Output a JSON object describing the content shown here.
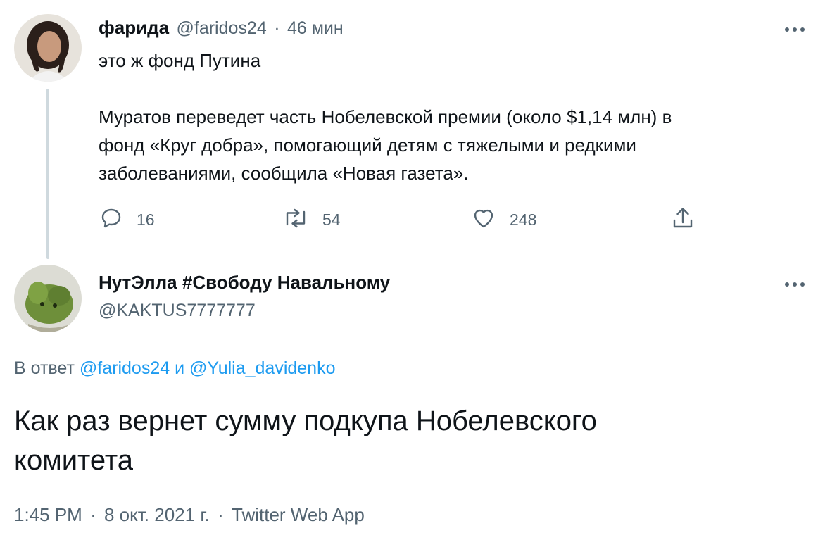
{
  "parent_tweet": {
    "author_name": "фарида",
    "author_handle": "@faridos24",
    "separator": "·",
    "time_ago": "46 мин",
    "text_line1": "это ж фонд Путина",
    "quote_line1": "Муратов переведет часть Нобелевской премии (около $1,14 млн) в",
    "quote_line2": "фонд «Круг добра», помогающий детям с тяжелыми и редкими",
    "quote_line3": "заболеваниями, сообщила «Новая газета».",
    "reply_count": "16",
    "retweet_count": "54",
    "like_count": "248"
  },
  "main_tweet": {
    "author_name": "НутЭлла #Свободу Навальному",
    "author_handle": "@KAKTUS7777777",
    "reply_prefix": "В ответ",
    "reply_user1": "@faridos24",
    "reply_conj": "и",
    "reply_user2": "@Yulia_davidenko",
    "text_line1": "Как раз вернет сумму подкупа Нобелевского",
    "text_line2": "комитета",
    "time": "1:45 PM",
    "date": "8 окт. 2021 г.",
    "source": "Twitter Web App",
    "dot": "·"
  },
  "icons": {
    "reply": "reply-icon",
    "retweet": "retweet-icon",
    "like": "heart-icon",
    "share": "share-icon",
    "more": "more-icon"
  },
  "colors": {
    "link": "#1d9bf0",
    "secondary": "#536471",
    "primary": "#0f1419"
  }
}
